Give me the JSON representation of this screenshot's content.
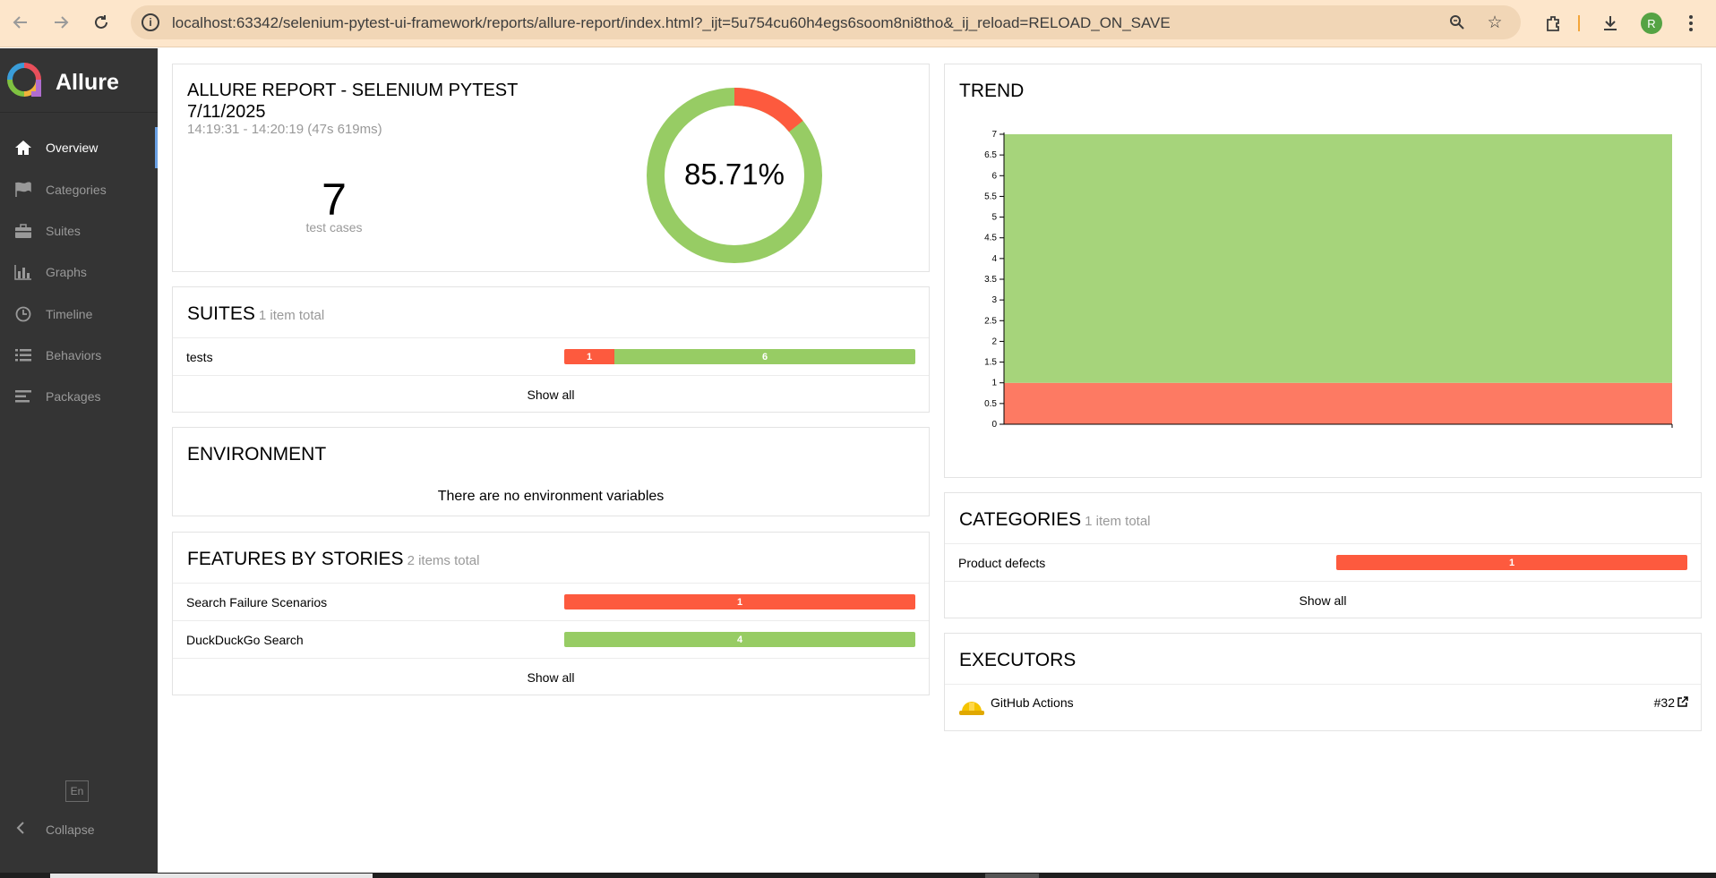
{
  "browser": {
    "url": "localhost:63342/selenium-pytest-ui-framework/reports/allure-report/index.html?_ijt=5u754cu60h4egs6soom8ni8tho&_ij_reload=RELOAD_ON_SAVE",
    "avatar_letter": "R"
  },
  "sidebar": {
    "brand": "Allure",
    "items": [
      {
        "label": "Overview",
        "icon": "home-icon",
        "active": true
      },
      {
        "label": "Categories",
        "icon": "flag-icon"
      },
      {
        "label": "Suites",
        "icon": "briefcase-icon"
      },
      {
        "label": "Graphs",
        "icon": "bar-chart-icon"
      },
      {
        "label": "Timeline",
        "icon": "clock-icon"
      },
      {
        "label": "Behaviors",
        "icon": "list-icon"
      },
      {
        "label": "Packages",
        "icon": "align-left-icon"
      }
    ],
    "language": "En",
    "collapse": "Collapse"
  },
  "summary": {
    "title_line1": "ALLURE REPORT - SELENIUM PYTEST",
    "title_line2": "7/11/2025",
    "time_range": "14:19:31 - 14:20:19 (47s 619ms)",
    "test_count": "7",
    "test_count_label": "test cases",
    "success_rate": "85.71%",
    "passed": 6,
    "failed": 1
  },
  "suites": {
    "title": "SUITES",
    "subtitle": "1 item total",
    "rows": [
      {
        "name": "tests",
        "failed": 1,
        "passed": 6
      }
    ],
    "show_all": "Show all"
  },
  "environment": {
    "title": "ENVIRONMENT",
    "empty_text": "There are no environment variables"
  },
  "features": {
    "title": "FEATURES BY STORIES",
    "subtitle": "2 items total",
    "rows": [
      {
        "name": "Search Failure Scenarios",
        "failed": 1,
        "passed": 0
      },
      {
        "name": "DuckDuckGo Search",
        "failed": 0,
        "passed": 4
      }
    ],
    "show_all": "Show all"
  },
  "trend": {
    "title": "TREND"
  },
  "chart_data": {
    "type": "area",
    "ylim": [
      0,
      7
    ],
    "yticks": [
      "0",
      "0.5",
      "1",
      "1.5",
      "2",
      "2.5",
      "3",
      "3.5",
      "4",
      "4.5",
      "5",
      "5.5",
      "6",
      "6.5",
      "7"
    ],
    "series": [
      {
        "values": [
          1,
          1
        ],
        "color": "#fd7a63"
      },
      {
        "values": [
          6,
          6
        ],
        "color": "#a6d47b"
      }
    ]
  },
  "categories": {
    "title": "CATEGORIES",
    "subtitle": "1 item total",
    "rows": [
      {
        "name": "Product defects",
        "count": 1
      }
    ],
    "show_all": "Show all"
  },
  "executors": {
    "title": "EXECUTORS",
    "name": "GitHub Actions",
    "build": "#32"
  },
  "colors": {
    "failed": "#fd5a3e",
    "passed": "#97cc64",
    "sidebar": "#343434"
  }
}
